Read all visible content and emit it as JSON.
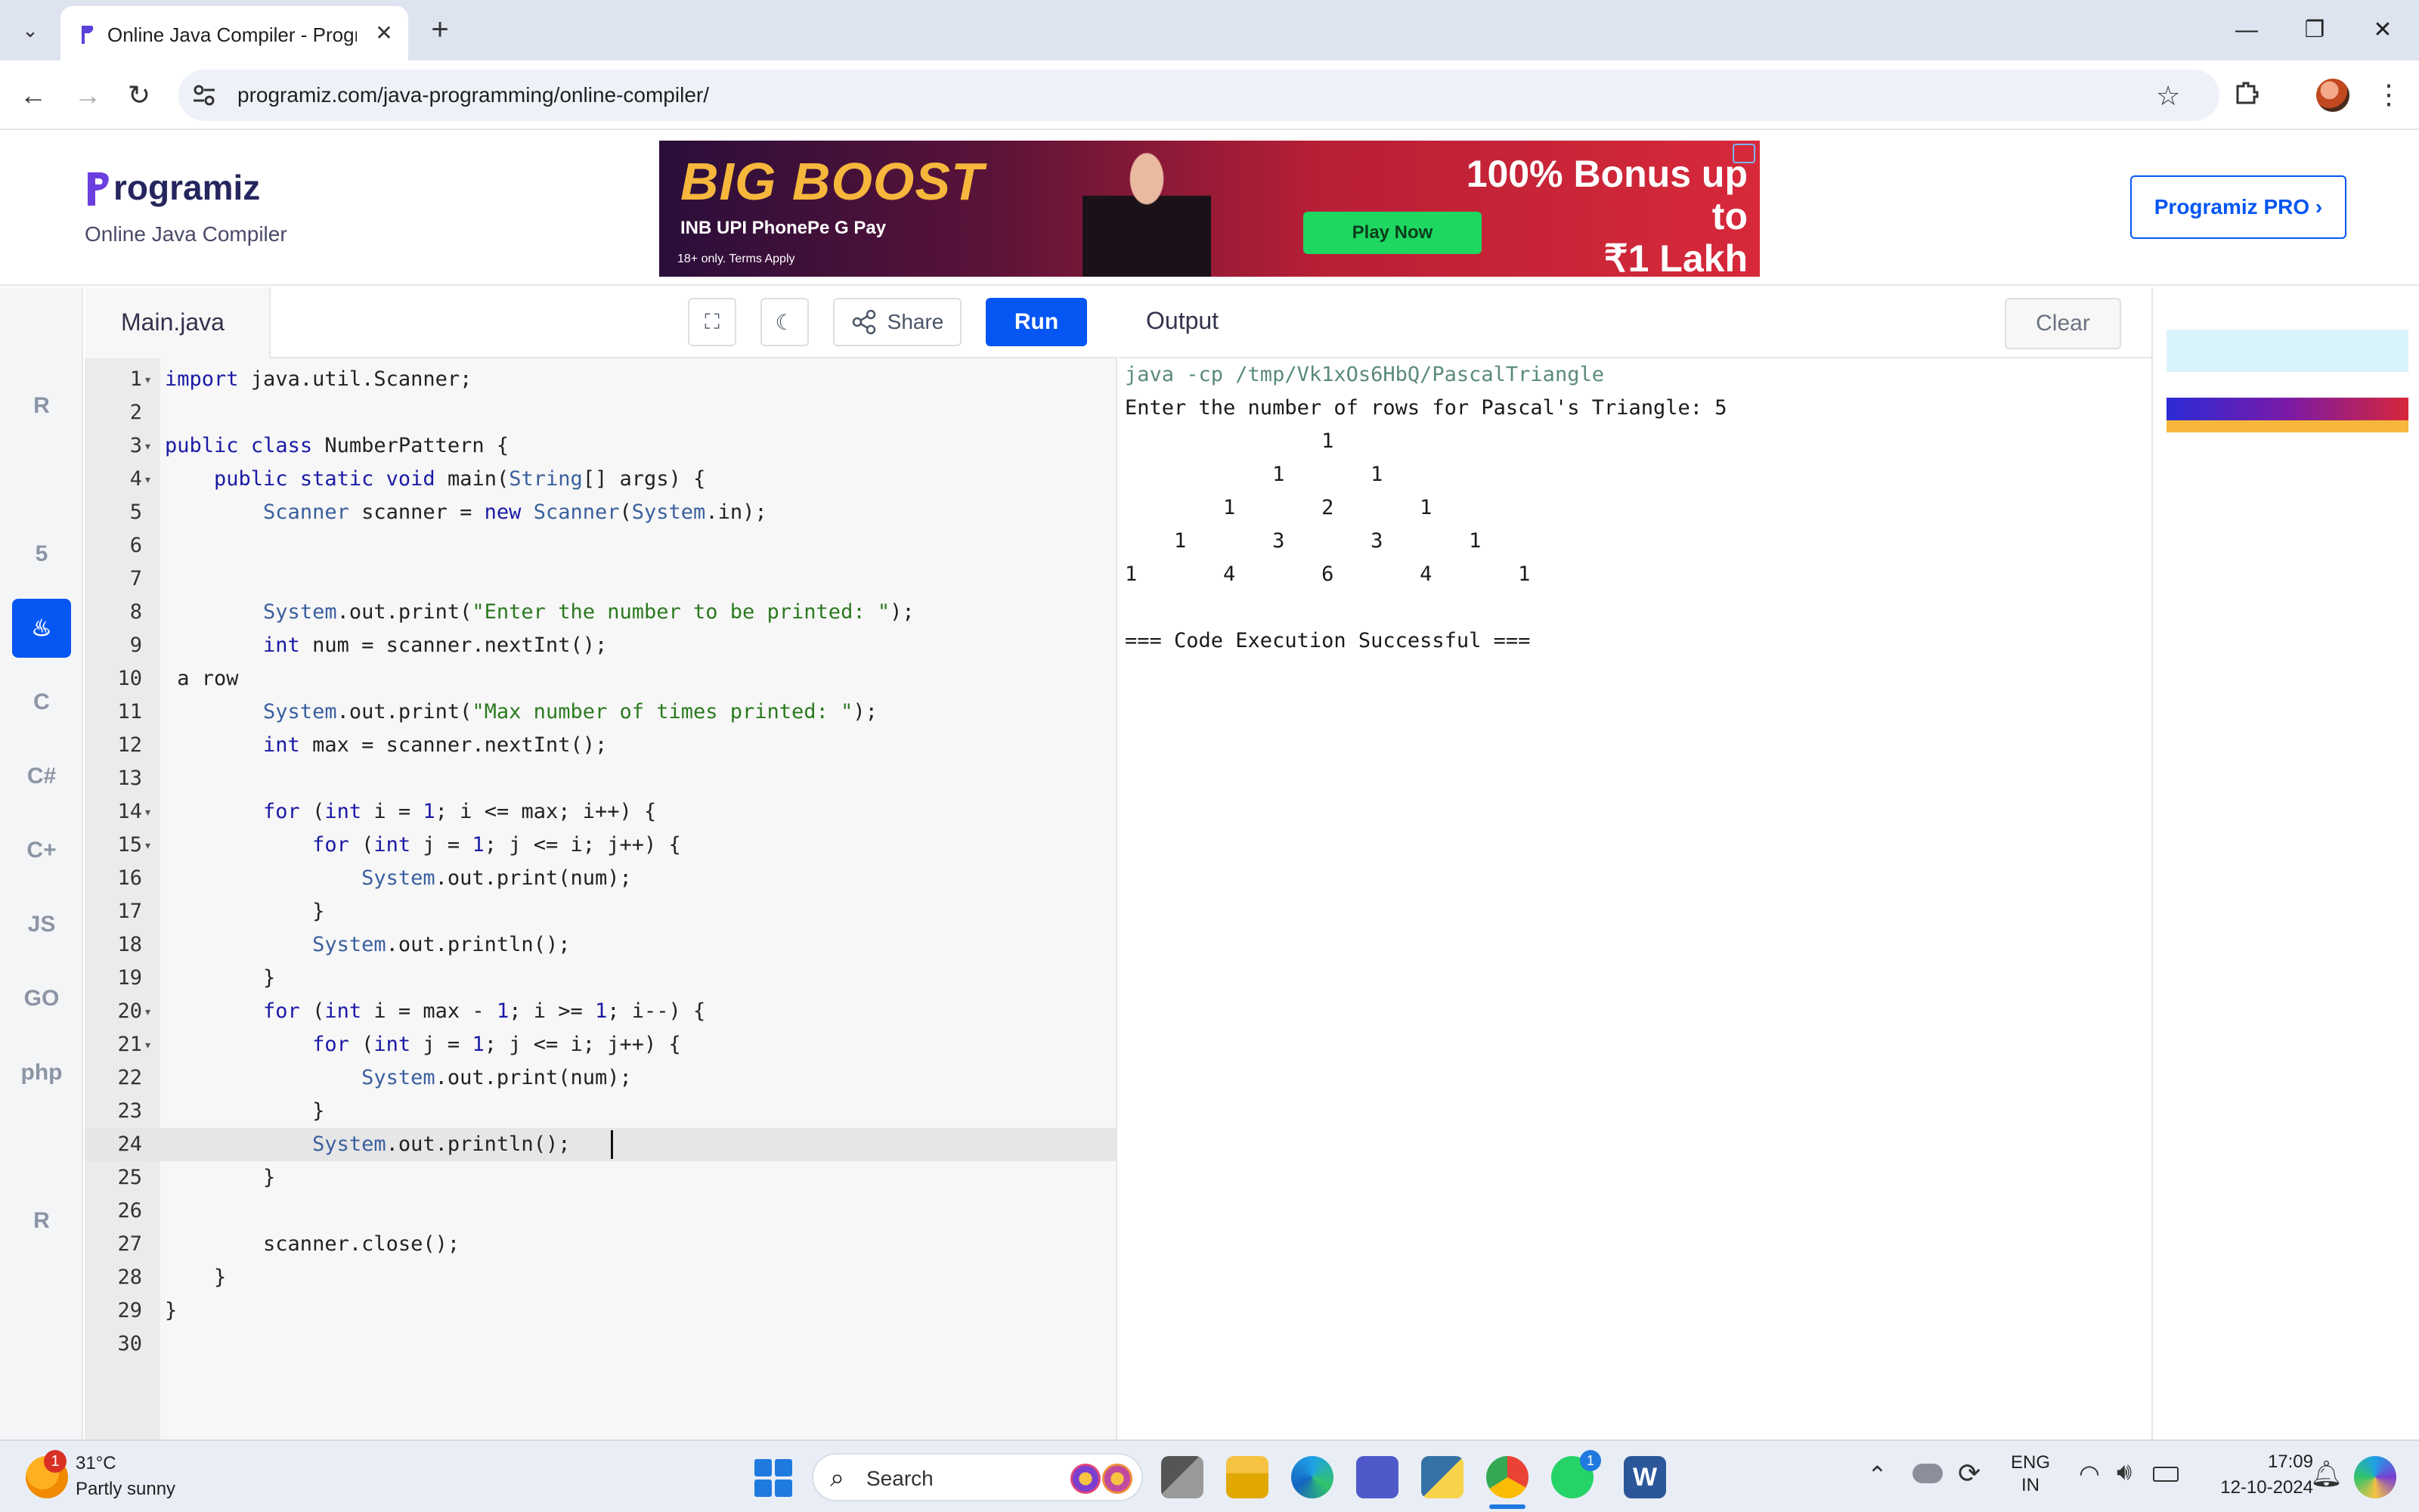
{
  "browser": {
    "tab_title": "Online Java Compiler - Program",
    "url": "programiz.com/java-programming/online-compiler/",
    "window_controls": [
      "—",
      "❐",
      "✕"
    ]
  },
  "site": {
    "logo": "rogramiz",
    "subtitle": "Online Java Compiler",
    "pro_button": "Programiz PRO ›"
  },
  "ad": {
    "headline": "BIG BOOST",
    "logos": "INB    UPI    PhonePe    G Pay",
    "terms": "18+ only. Terms Apply",
    "bonus_line1": "100% Bonus up to",
    "bonus_line2": "₹1 Lakh",
    "play_button": "Play Now"
  },
  "sidebar": {
    "languages": [
      "python",
      "r",
      "sql",
      "html5",
      "java",
      "c",
      "csharp",
      "cpp",
      "javascript",
      "go",
      "php",
      "swift",
      "rust"
    ],
    "labels": [
      "",
      "R",
      "",
      "5",
      "♨",
      "C",
      "C#",
      "C+",
      "JS",
      "GO",
      "php",
      "",
      "R"
    ],
    "active": "java"
  },
  "editor": {
    "file_name": "Main.java",
    "share_label": "Share",
    "run_label": "Run",
    "active_line": 24,
    "lines": [
      "import java.util.Scanner;",
      "",
      "public class NumberPattern {",
      "    public static void main(String[] args) {",
      "        Scanner scanner = new Scanner(System.in);",
      "",
      "",
      "        System.out.print(\"Enter the number to be printed: \");",
      "        int num = scanner.nextInt();",
      " a row",
      "        System.out.print(\"Max number of times printed: \");",
      "        int max = scanner.nextInt();",
      "",
      "        for (int i = 1; i <= max; i++) {",
      "            for (int j = 1; j <= i; j++) {",
      "                System.out.print(num);",
      "            }",
      "            System.out.println();",
      "        }",
      "        for (int i = max - 1; i >= 1; i--) {",
      "            for (int j = 1; j <= i; j++) {",
      "                System.out.print(num);",
      "            }",
      "            System.out.println();",
      "        }",
      "",
      "        scanner.close();",
      "    }",
      "}",
      ""
    ],
    "fold_lines": [
      1,
      3,
      4,
      14,
      15,
      20,
      21
    ]
  },
  "output": {
    "title": "Output",
    "clear_label": "Clear",
    "command": "java -cp /tmp/Vk1xOs6HbQ/PascalTriangle",
    "lines": [
      "Enter the number of rows for Pascal's Triangle: 5",
      "                1",
      "            1       1",
      "        1       2       1",
      "    1       3       3       1",
      "1       4       6       4       1",
      "",
      "=== Code Execution Successful ==="
    ]
  },
  "taskbar": {
    "weather_temp": "31°C",
    "weather_desc": "Partly sunny",
    "weather_badge": "1",
    "search_label": "Search",
    "lang_line1": "ENG",
    "lang_line2": "IN",
    "time": "17:09",
    "date": "12-10-2024",
    "whatsapp_badge": "1"
  },
  "colors": {
    "accent": "#0556f3",
    "editor_bg": "#f7f7f7",
    "command_color": "#5a8a7a"
  }
}
